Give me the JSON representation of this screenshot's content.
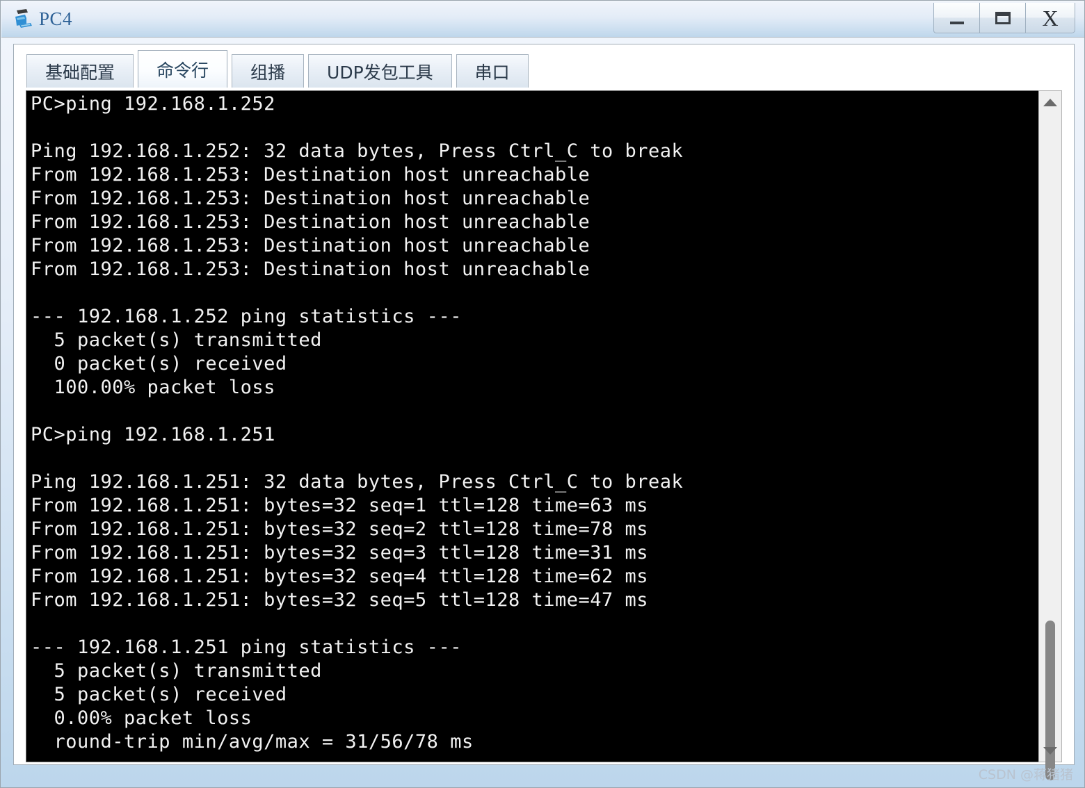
{
  "window": {
    "title": "PC4",
    "icon": "pc-computer-icon",
    "buttons": {
      "minimize": "_",
      "maximize": "☐",
      "close": "X"
    },
    "accent_color": "#2d6196",
    "titlebar_gradient_top": "#f0f4fb",
    "titlebar_gradient_bottom": "#bfd7ec"
  },
  "tabs": [
    {
      "label": "基础配置",
      "active": false
    },
    {
      "label": "命令行",
      "active": true
    },
    {
      "label": "组播",
      "active": false
    },
    {
      "label": "UDP发包工具",
      "active": false
    },
    {
      "label": "串口",
      "active": false
    }
  ],
  "terminal": {
    "background": "#000000",
    "foreground": "#f2f2f2",
    "lines": [
      "PC>ping 192.168.1.252",
      "",
      "Ping 192.168.1.252: 32 data bytes, Press Ctrl_C to break",
      "From 192.168.1.253: Destination host unreachable",
      "From 192.168.1.253: Destination host unreachable",
      "From 192.168.1.253: Destination host unreachable",
      "From 192.168.1.253: Destination host unreachable",
      "From 192.168.1.253: Destination host unreachable",
      "",
      "--- 192.168.1.252 ping statistics ---",
      "  5 packet(s) transmitted",
      "  0 packet(s) received",
      "  100.00% packet loss",
      "",
      "PC>ping 192.168.1.251",
      "",
      "Ping 192.168.1.251: 32 data bytes, Press Ctrl_C to break",
      "From 192.168.1.251: bytes=32 seq=1 ttl=128 time=63 ms",
      "From 192.168.1.251: bytes=32 seq=2 ttl=128 time=78 ms",
      "From 192.168.1.251: bytes=32 seq=3 ttl=128 time=31 ms",
      "From 192.168.1.251: bytes=32 seq=4 ttl=128 time=62 ms",
      "From 192.168.1.251: bytes=32 seq=5 ttl=128 time=47 ms",
      "",
      "--- 192.168.1.251 ping statistics ---",
      "  5 packet(s) transmitted",
      "  5 packet(s) received",
      "  0.00% packet loss",
      "  round-trip min/avg/max = 31/56/78 ms"
    ]
  },
  "scrollbar": {
    "up_arrow": "▲",
    "down_arrow": "▼",
    "thumb_position_percent": 79
  },
  "watermark": "CSDN @蒋猪猪"
}
